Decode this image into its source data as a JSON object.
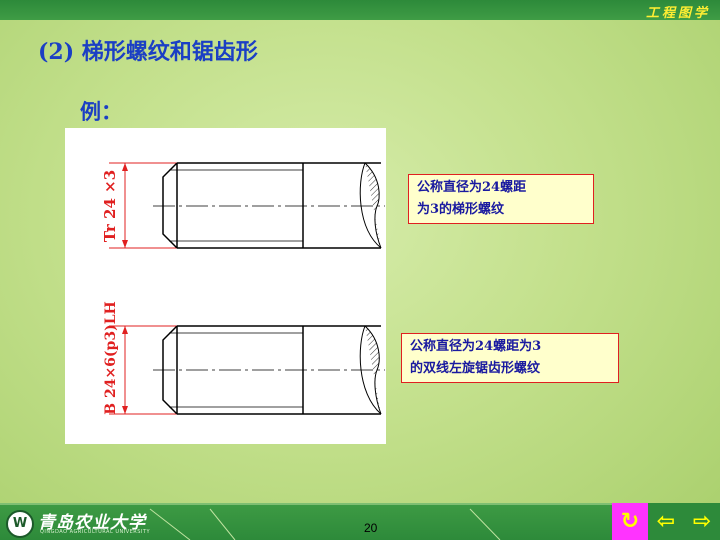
{
  "header": {
    "course_title": "工程图学"
  },
  "slide": {
    "heading": "(2) 梯形螺纹和锯齿形",
    "example_label": "例：",
    "drawing": {
      "label_top": "Tr 24 ×3",
      "label_bottom": "B 24×6(p3)LH"
    },
    "note_top": {
      "line1": "公称直径为24螺距",
      "line2": "为3的梯形螺纹"
    },
    "note_bottom": {
      "line1": "公称直径为24螺距为3",
      "line2": "的双线左旋锯齿形螺纹"
    }
  },
  "footer": {
    "logo_emblem": "W",
    "logo_text": "青岛农业大学",
    "logo_subtext": "QINGDAO AGRICULTURAL UNIVERSITY",
    "page_number": "20",
    "nav_return_symbol": "↻",
    "nav_prev_symbol": "⇦",
    "nav_next_symbol": "⇨"
  },
  "colors": {
    "heading": "#1b3fc4",
    "note_border": "#e02020",
    "label": "#e02020",
    "nav_return_bg": "#ff33ff"
  }
}
